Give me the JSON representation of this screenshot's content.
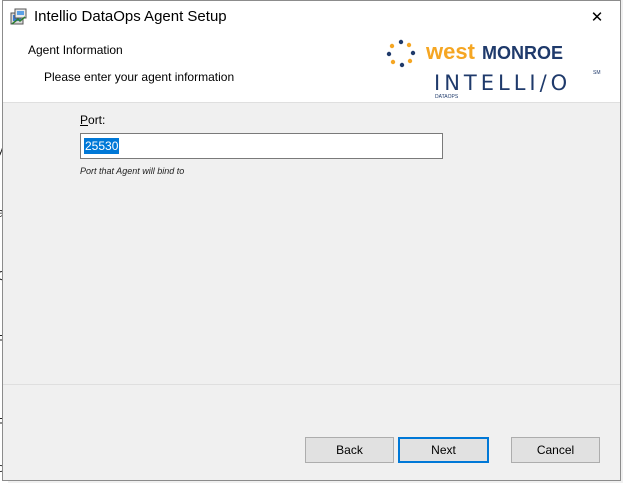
{
  "window": {
    "title": "Intellio DataOps Agent Setup",
    "close_symbol": "✕"
  },
  "header": {
    "title": "Agent Information",
    "description": "Please enter your agent information",
    "logo": {
      "brand_west": "west",
      "brand_monroe": "MONROE",
      "product": "INTELLI/O",
      "product_sub": "DATAOPS",
      "trademark": "SM",
      "colors": {
        "west": "#f5a623",
        "monroe": "#1f3a6b",
        "intellio": "#1f3a6b"
      }
    }
  },
  "form": {
    "port_label_access": "P",
    "port_label_rest": "ort:",
    "port_value": "25530",
    "port_hint": "Port that Agent will bind to"
  },
  "buttons": {
    "back": "Back",
    "next": "Next",
    "cancel": "Cancel"
  },
  "colors": {
    "selection": "#0078d7",
    "default_button_border": "#0078d7"
  }
}
